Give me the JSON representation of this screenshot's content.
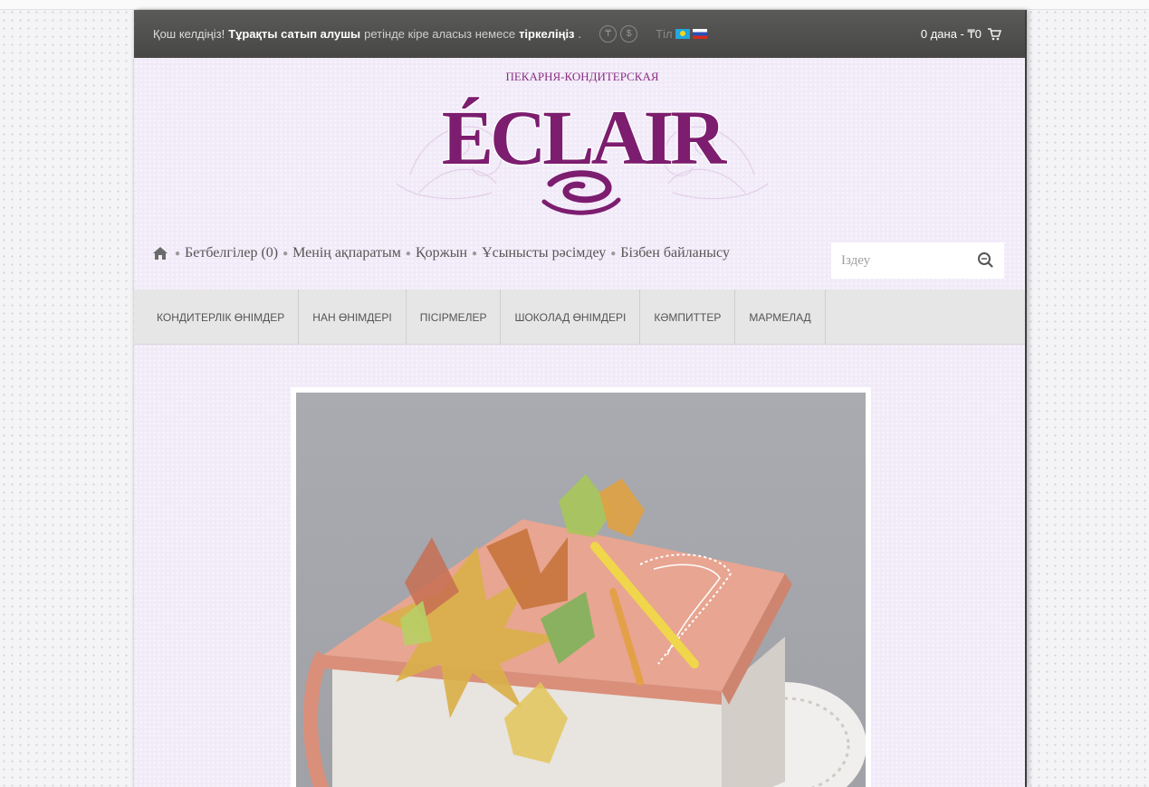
{
  "topbar": {
    "welcome": "Қош келдіңіз!",
    "regular_customer": "Тұрақты сатып алушы",
    "login_text": "ретінде кіре аласыз немесе",
    "register": "тіркеліңіз",
    "register_suffix": ".",
    "currency_tenge": "₸",
    "currency_dollar": "$",
    "language_label": "Тіл",
    "cart_summary": "0 дана - ₸0"
  },
  "logo": {
    "subtitle": "ПЕКАРНЯ-КОНДИТЕРСКАЯ",
    "brand": "ÉCLAIR"
  },
  "links": {
    "bookmarks": "Бетбелгілер (0)",
    "my_info": "Менің ақпаратым",
    "basket": "Қоржын",
    "checkout": "Ұсынысты рәсімдеу",
    "contact": "Бізбен байланысу"
  },
  "search": {
    "placeholder": "Іздеу"
  },
  "menu": {
    "items": [
      "КОНДИТЕРЛІК ӨНІМДЕР",
      "НАН ӨНІМДЕРІ",
      "ПІСІРМЕЛЕР",
      "ШОКОЛАД ӨНІМДЕРІ",
      "КӘМПИТТЕР",
      "МАРМЕЛАД"
    ]
  },
  "colors": {
    "topbar": "#4f4f4d",
    "shell_bg": "#f1eaf8",
    "brand_purple": "#7c1d6f",
    "menu_bg": "#e6e6e6"
  }
}
